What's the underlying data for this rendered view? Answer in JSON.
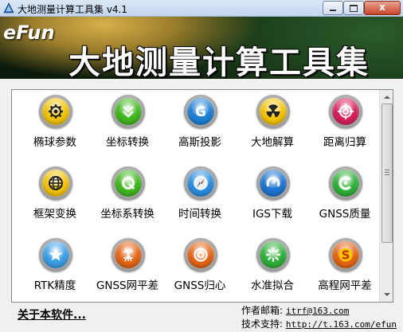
{
  "window": {
    "title": "大地测量计算工具集 v4.1",
    "close_label": "x"
  },
  "banner": {
    "logo": "eFun",
    "title": "大地测量计算工具集"
  },
  "tools": [
    {
      "label": "椭球参数",
      "icon": "gear-icon",
      "color": "#f5c400"
    },
    {
      "label": "坐标转换",
      "icon": "double-chevron-down-icon",
      "color": "#3fb81e"
    },
    {
      "label": "高斯投影",
      "icon": "g-letter-icon",
      "color": "#1e7fd6"
    },
    {
      "label": "大地解算",
      "icon": "radiation-icon",
      "color": "#f5c400"
    },
    {
      "label": "距离归算",
      "icon": "crosshair-icon",
      "color": "#d8205a"
    },
    {
      "label": "框架变换",
      "icon": "globe-icon",
      "color": "#f5c400"
    },
    {
      "label": "坐标系转换",
      "icon": "q-letter-icon",
      "color": "#3fb81e"
    },
    {
      "label": "时间转换",
      "icon": "compass-icon",
      "color": "#2a8ee0"
    },
    {
      "label": "IGS下载",
      "icon": "download-arc-icon",
      "color": "#1e74d0"
    },
    {
      "label": "GNSS质量",
      "icon": "c-ring-icon",
      "color": "#2fb03a"
    },
    {
      "label": "RTK精度",
      "icon": "star-icon",
      "color": "#3aa0e6"
    },
    {
      "label": "GNSS网平差",
      "icon": "lattice-icon",
      "color": "#e66414"
    },
    {
      "label": "GNSS归心",
      "icon": "target-ring-icon",
      "color": "#e66414"
    },
    {
      "label": "水准拟合",
      "icon": "spinner-icon",
      "color": "#2fb03a"
    },
    {
      "label": "高程网平差",
      "icon": "dollar-s-icon",
      "color": "#e66414"
    }
  ],
  "footer": {
    "about": "关于本软件...",
    "email_label": "作者邮箱:",
    "email": "itrf@163.com",
    "support_label": "技术支持:",
    "support_url": "http://t.163.com/efun"
  }
}
